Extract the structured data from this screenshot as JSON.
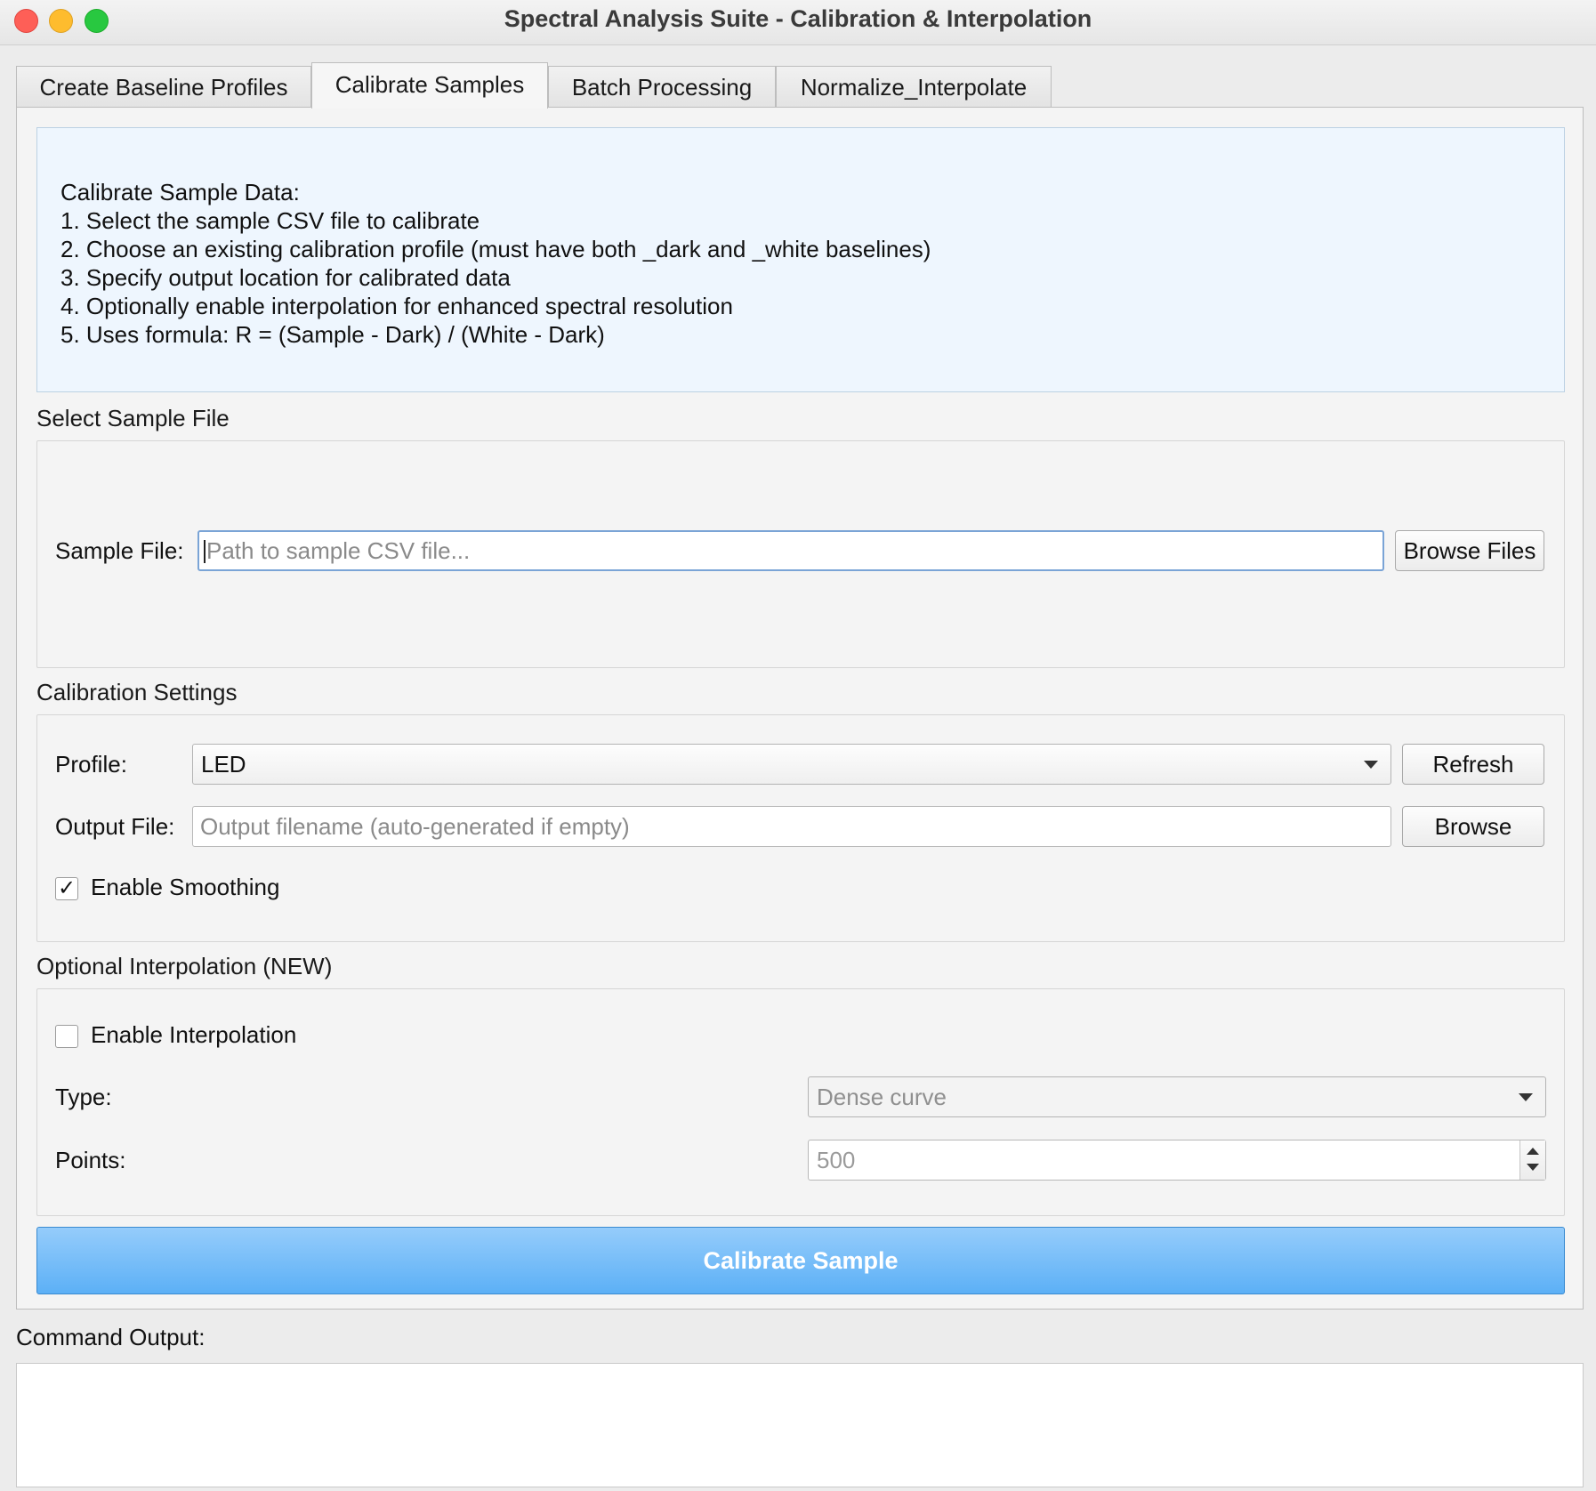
{
  "window": {
    "title": "Spectral Analysis Suite - Calibration & Interpolation"
  },
  "tabs": [
    {
      "label": "Create Baseline Profiles",
      "active": false
    },
    {
      "label": "Calibrate Samples",
      "active": true
    },
    {
      "label": "Batch Processing",
      "active": false
    },
    {
      "label": "Normalize_Interpolate",
      "active": false
    }
  ],
  "info": {
    "lines": [
      "Calibrate Sample Data:",
      "1. Select the sample CSV file to calibrate",
      "2. Choose an existing calibration profile (must have both _dark and _white baselines)",
      "3. Specify output location for calibrated data",
      "4. Optionally enable interpolation for enhanced spectral resolution",
      "5. Uses formula: R = (Sample - Dark) / (White - Dark)"
    ]
  },
  "sample_section": {
    "title": "Select Sample File",
    "file_label": "Sample File:",
    "file_value": "",
    "file_placeholder": "Path to sample CSV file...",
    "browse_label": "Browse Files"
  },
  "calibration_section": {
    "title": "Calibration Settings",
    "profile_label": "Profile:",
    "profile_value": "LED",
    "refresh_label": "Refresh",
    "output_label": "Output File:",
    "output_value": "",
    "output_placeholder": "Output filename (auto-generated if empty)",
    "browse_label": "Browse",
    "smoothing_label": "Enable Smoothing",
    "smoothing_checked": true
  },
  "interpolation_section": {
    "title": "Optional Interpolation (NEW)",
    "enable_label": "Enable Interpolation",
    "enable_checked": false,
    "type_label": "Type:",
    "type_value": "Dense curve",
    "points_label": "Points:",
    "points_value": "500"
  },
  "actions": {
    "calibrate_label": "Calibrate Sample"
  },
  "command_output": {
    "label": "Command Output:",
    "text": ""
  },
  "colors": {
    "primary_button": "#5cb0f6",
    "info_background": "#eef6fe",
    "close": "#fe5f57",
    "minimize": "#febc2e",
    "zoom": "#28c840"
  }
}
